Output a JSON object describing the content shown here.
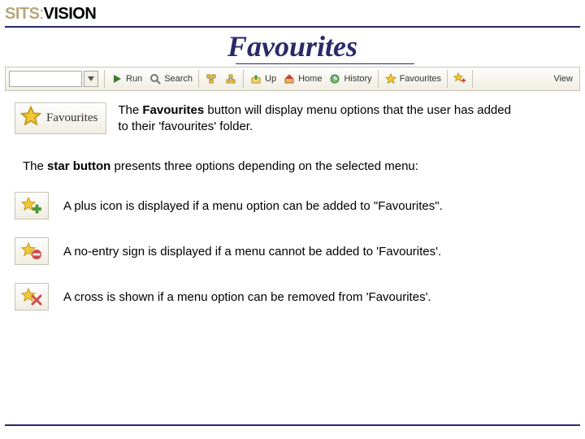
{
  "logo": {
    "sits": "SITS",
    "colon": ":",
    "vision": "VISION"
  },
  "title": "Favourites",
  "toolbar": {
    "run": "Run",
    "search": "Search",
    "up": "Up",
    "home": "Home",
    "history": "History",
    "favourites": "Favourites",
    "view": "View"
  },
  "fav_button_label": "Favourites",
  "desc_part1": "The ",
  "desc_bold": "Favourites",
  "desc_part2": " button will display menu options that the user has added to their 'favourites' folder.",
  "line2_part1": "The ",
  "line2_bold": "star button",
  "line2_part2": " presents three options depending on the selected menu:",
  "opt1": "A plus icon is displayed if a menu option can be added to \"Favourites\".",
  "opt2": "A no-entry sign is displayed if a menu cannot be added to 'Favourites'.",
  "opt3": "A cross is shown if a menu option can be removed from 'Favourites'."
}
